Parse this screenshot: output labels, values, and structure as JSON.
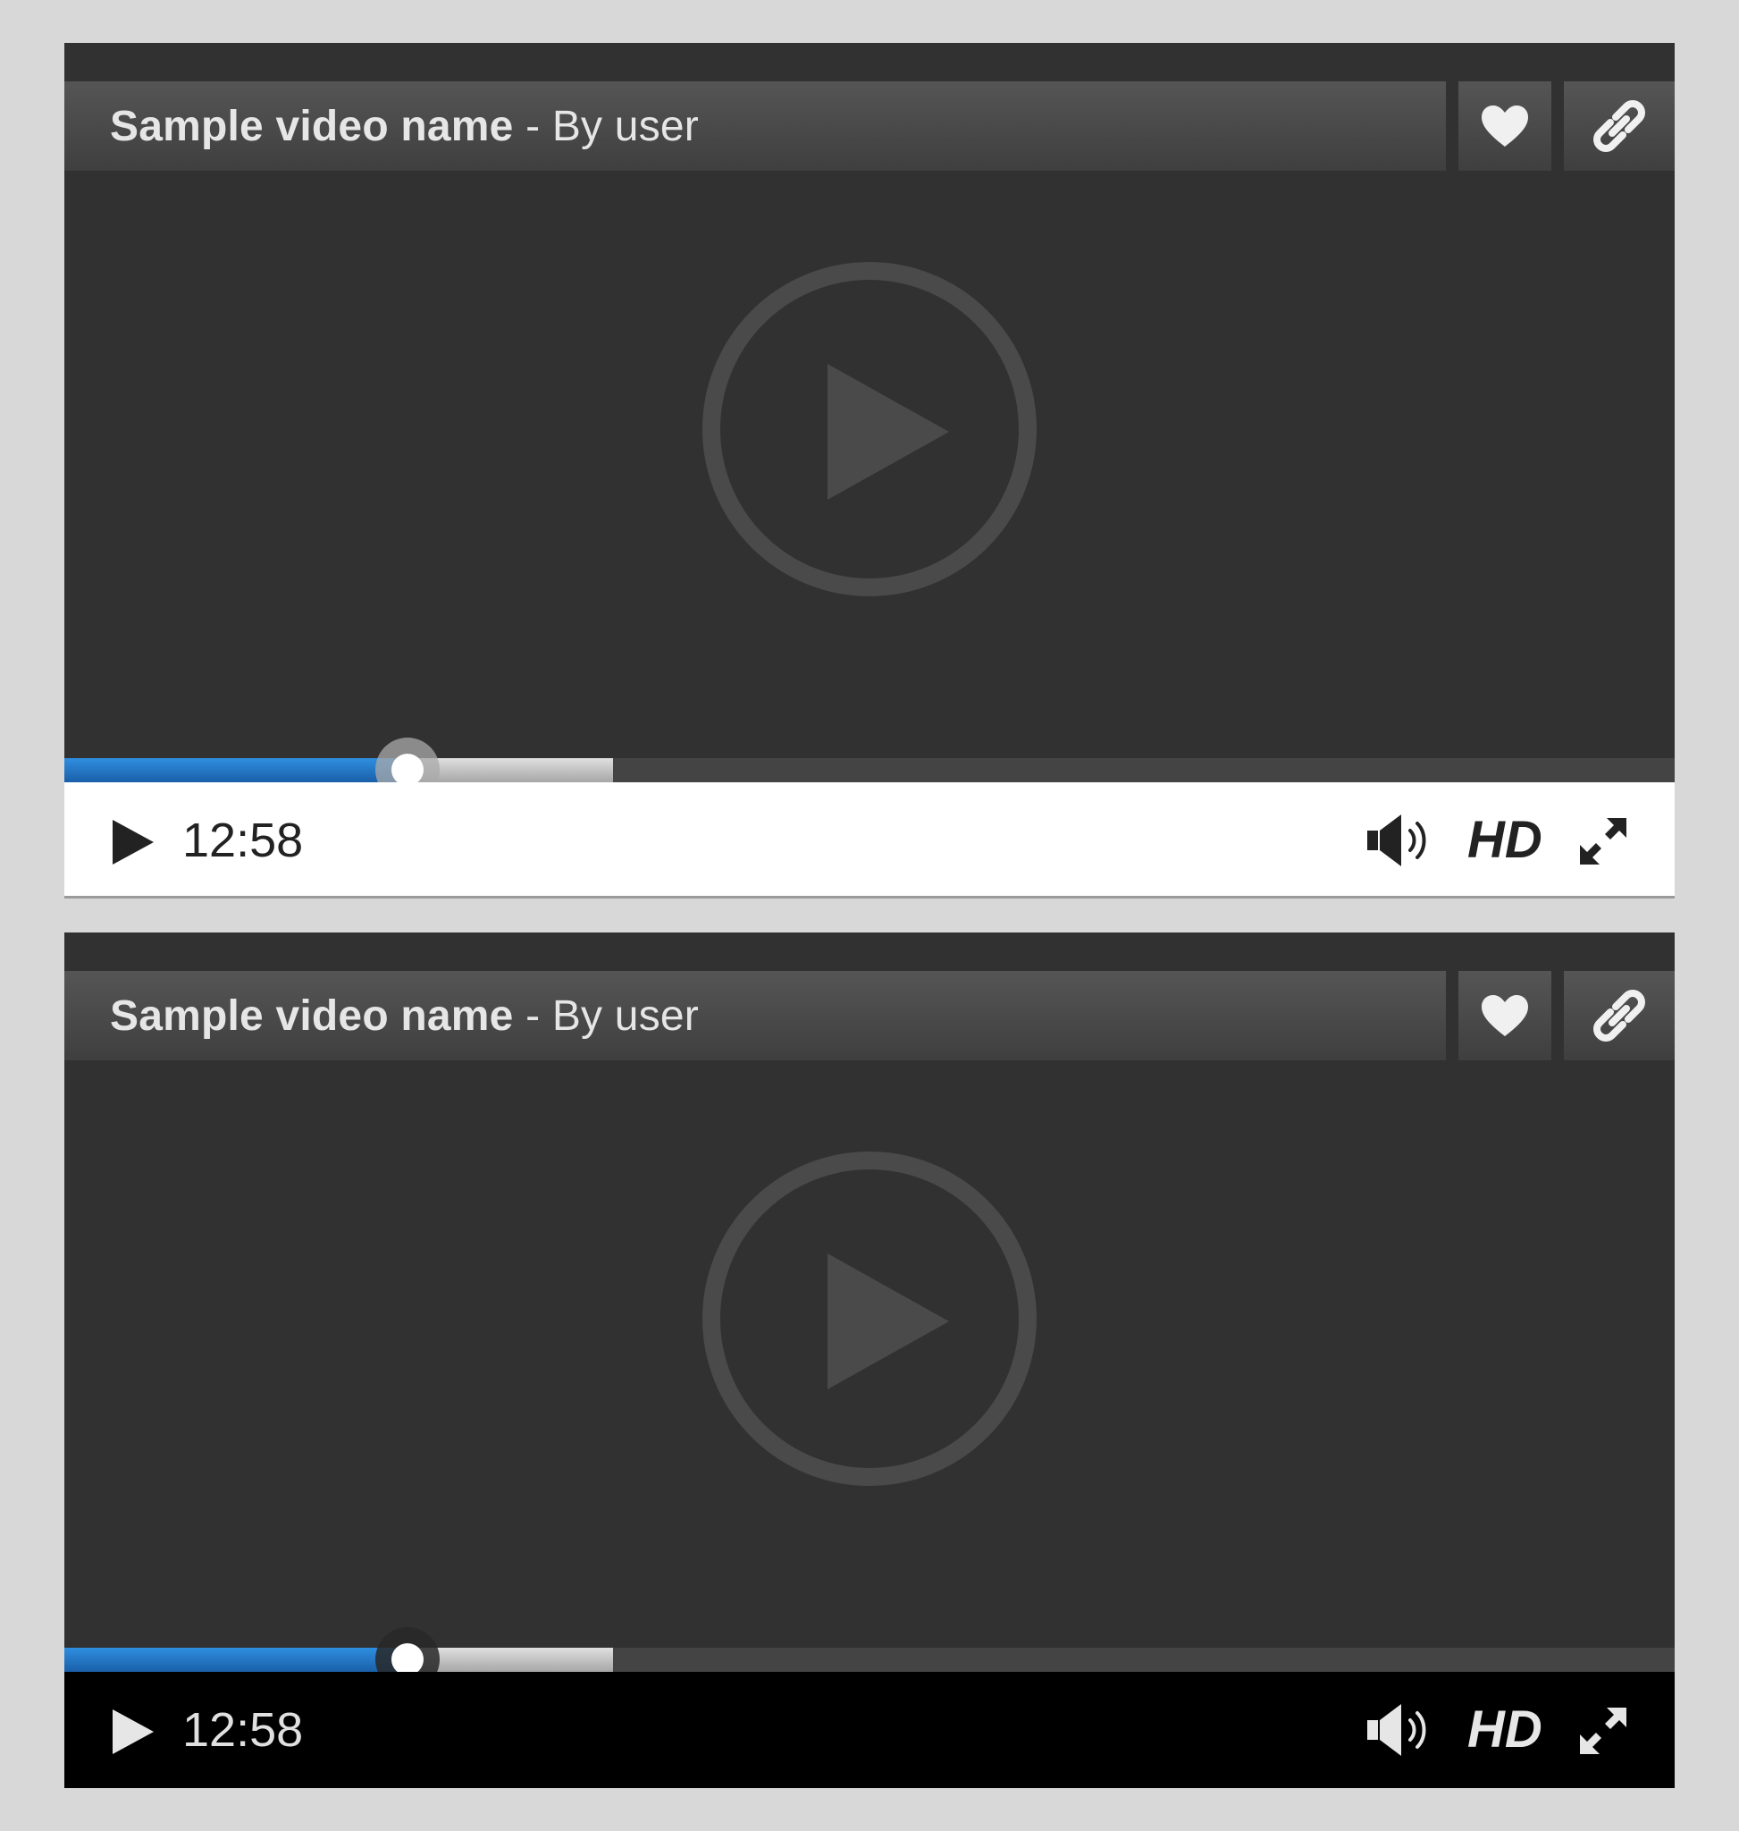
{
  "players": [
    {
      "theme": "light",
      "title": {
        "name": "Sample video name",
        "separator": " - ",
        "by": "By user"
      },
      "time": "12:58",
      "hd_label": "HD",
      "progress": {
        "played": 0.213,
        "buffered": 0.341
      },
      "icons": [
        "heart-icon",
        "link-icon",
        "play-circle-icon",
        "play-icon",
        "volume-icon",
        "fullscreen-icon"
      ],
      "colors": {
        "controls_bg": "#ffffff",
        "controls_fg": "#222222",
        "accent": "#2a86d6"
      }
    },
    {
      "theme": "dark",
      "title": {
        "name": "Sample video name",
        "separator": " - ",
        "by": "By user"
      },
      "time": "12:58",
      "hd_label": "HD",
      "progress": {
        "played": 0.213,
        "buffered": 0.341
      },
      "icons": [
        "heart-icon",
        "link-icon",
        "play-circle-icon",
        "play-icon",
        "volume-icon",
        "fullscreen-icon"
      ],
      "colors": {
        "controls_bg": "#000000",
        "controls_fg": "#e6e6e6",
        "accent": "#2a86d6"
      }
    }
  ],
  "colors": {
    "page_background": "#d8d8d8",
    "player_background": "#313131"
  }
}
